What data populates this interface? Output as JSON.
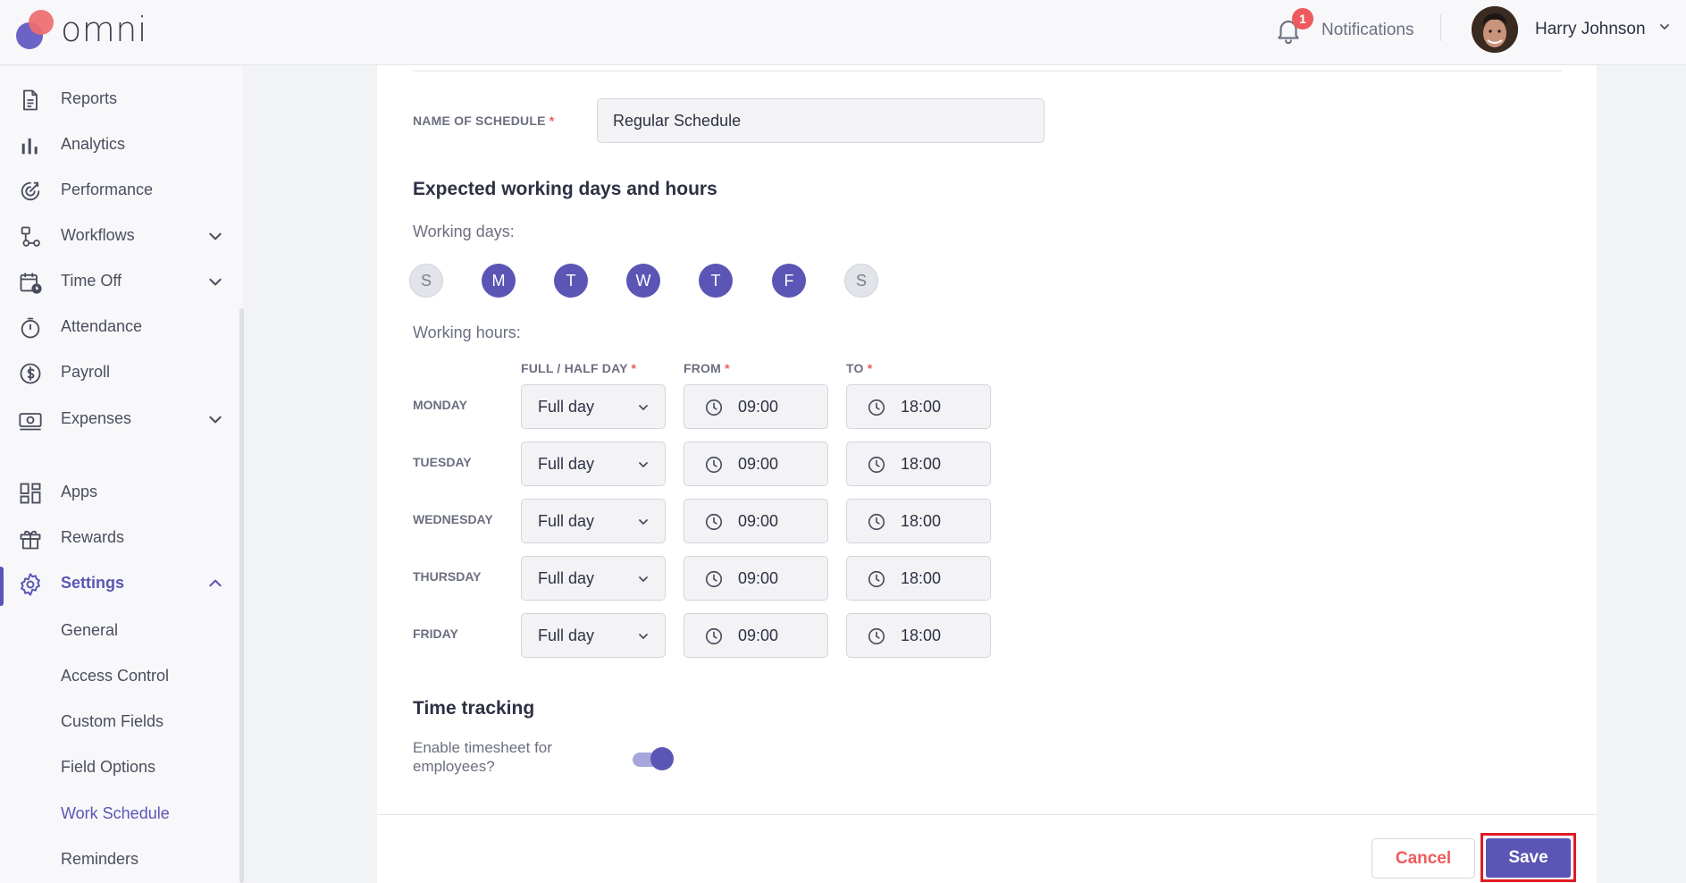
{
  "app": {
    "logo_text": "omni"
  },
  "header": {
    "notifications_label": "Notifications",
    "notifications_count": "1",
    "user_name": "Harry Johnson"
  },
  "sidebar": {
    "items": [
      {
        "label": "Reports",
        "icon": "document-icon"
      },
      {
        "label": "Analytics",
        "icon": "bar-chart-icon"
      },
      {
        "label": "Performance",
        "icon": "target-icon"
      },
      {
        "label": "Workflows",
        "icon": "workflow-icon",
        "expandable": true
      },
      {
        "label": "Time Off",
        "icon": "calendar-clock-icon",
        "expandable": true
      },
      {
        "label": "Attendance",
        "icon": "stopwatch-icon"
      },
      {
        "label": "Payroll",
        "icon": "dollar-circle-icon"
      },
      {
        "label": "Expenses",
        "icon": "cash-icon",
        "expandable": true
      },
      {
        "label": "Apps",
        "icon": "grid-icon"
      },
      {
        "label": "Rewards",
        "icon": "gift-icon"
      },
      {
        "label": "Settings",
        "icon": "gear-icon",
        "expanded": true
      }
    ],
    "settings_sub": [
      "General",
      "Access Control",
      "Custom Fields",
      "Field Options",
      "Work Schedule",
      "Reminders"
    ],
    "current_sub": "Work Schedule"
  },
  "form": {
    "name_label": "NAME OF SCHEDULE",
    "name_value": "Regular Schedule",
    "section_title": "Expected working days and hours",
    "working_days_label": "Working days:",
    "days": [
      {
        "letter": "S",
        "selected": false
      },
      {
        "letter": "M",
        "selected": true
      },
      {
        "letter": "T",
        "selected": true
      },
      {
        "letter": "W",
        "selected": true
      },
      {
        "letter": "T",
        "selected": true
      },
      {
        "letter": "F",
        "selected": true
      },
      {
        "letter": "S",
        "selected": false
      }
    ],
    "working_hours_label": "Working hours:",
    "columns": {
      "type": "FULL / HALF DAY",
      "from": "FROM",
      "to": "TO"
    },
    "rows": [
      {
        "day": "MONDAY",
        "type": "Full day",
        "from": "09:00",
        "to": "18:00"
      },
      {
        "day": "TUESDAY",
        "type": "Full day",
        "from": "09:00",
        "to": "18:00"
      },
      {
        "day": "WEDNESDAY",
        "type": "Full day",
        "from": "09:00",
        "to": "18:00"
      },
      {
        "day": "THURSDAY",
        "type": "Full day",
        "from": "09:00",
        "to": "18:00"
      },
      {
        "day": "FRIDAY",
        "type": "Full day",
        "from": "09:00",
        "to": "18:00"
      }
    ],
    "tracking_title": "Time tracking",
    "timesheet_label_line1": "Enable timesheet for",
    "timesheet_label_line2": "employees?",
    "timesheet_enabled": true
  },
  "actions": {
    "cancel": "Cancel",
    "save": "Save"
  },
  "colors": {
    "accent": "#5b55b5",
    "danger": "#ee5a5d",
    "highlight": "#e01b24"
  }
}
